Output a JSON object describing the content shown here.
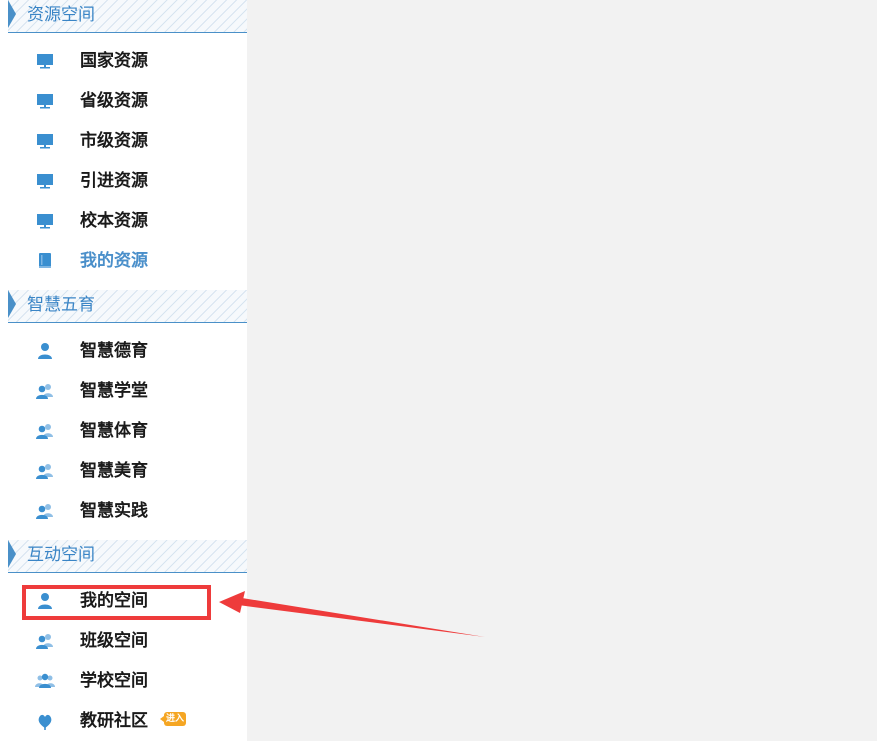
{
  "sections": [
    {
      "title": "资源空间",
      "items": [
        {
          "label": "国家资源",
          "icon": "monitor-icon"
        },
        {
          "label": "省级资源",
          "icon": "monitor-icon"
        },
        {
          "label": "市级资源",
          "icon": "monitor-icon"
        },
        {
          "label": "引进资源",
          "icon": "monitor-icon"
        },
        {
          "label": "校本资源",
          "icon": "monitor-icon"
        },
        {
          "label": "我的资源",
          "icon": "book-icon",
          "active": true
        }
      ]
    },
    {
      "title": "智慧五育",
      "items": [
        {
          "label": "智慧德育",
          "icon": "user-icon"
        },
        {
          "label": "智慧学堂",
          "icon": "users-icon"
        },
        {
          "label": "智慧体育",
          "icon": "users-icon"
        },
        {
          "label": "智慧美育",
          "icon": "users-icon"
        },
        {
          "label": "智慧实践",
          "icon": "users-icon"
        }
      ]
    },
    {
      "title": "互动空间",
      "items": [
        {
          "label": "我的空间",
          "icon": "user-icon",
          "highlighted": true
        },
        {
          "label": "班级空间",
          "icon": "users-icon"
        },
        {
          "label": "学校空间",
          "icon": "group-icon"
        },
        {
          "label": "教研社区",
          "icon": "heart-leaf-icon",
          "badge": "进入"
        }
      ]
    }
  ],
  "colors": {
    "accent": "#4a90c8",
    "active_text": "#4a8fca",
    "highlight": "#ee3b3b",
    "badge": "#f5a623"
  }
}
